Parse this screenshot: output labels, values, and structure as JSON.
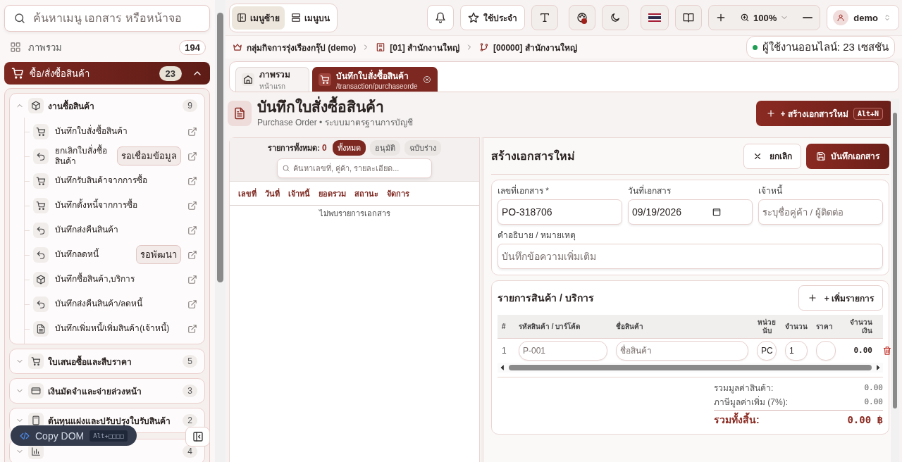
{
  "sidebar": {
    "search": {
      "placeholder": "ค้นหาเมนู เอกสาร หรือหน้าจอ"
    },
    "overview": {
      "label": "ภาพรวม",
      "count": "194"
    },
    "groups": [
      {
        "label": "ซื้อ/สั่งซื้อสินค้า",
        "count": "23",
        "expanded": true,
        "selected": true,
        "children": [
          {
            "label": "งานซื้อสินค้า",
            "count": "9",
            "kind": "box",
            "expanded": true,
            "children": [
              {
                "label": "บันทึกใบสั่งซื้อสินค้า",
                "kind": "cart"
              },
              {
                "label": "ยกเลิกใบสั่งซื้อสินค้า",
                "kind": "return",
                "badge": "รอเชื่อมข้อมูล"
              },
              {
                "label": "บันทึกรับสินค้าจากการซื้อ",
                "kind": "cart"
              },
              {
                "label": "บันทึกตั้งหนี้จากการซื้อ",
                "kind": "cart"
              },
              {
                "label": "บันทึกส่งคืนสินค้า",
                "kind": "return"
              },
              {
                "label": "บันทึกลดหนี้",
                "kind": "return",
                "badge": "รอพัฒนา"
              },
              {
                "label": "บันทึกซื้อสินค้า,บริการ",
                "kind": "box"
              },
              {
                "label": "บันทึกส่งคืนสินค้า/ลดหนี้",
                "kind": "return"
              },
              {
                "label": "บันทึกเพิ่มหนี้/เพิ่มสินค้า(เจ้าหนี้)",
                "kind": "document"
              }
            ]
          },
          {
            "label": "ใบเสนอซื้อและสืบราคา",
            "count": "5",
            "kind": "cart",
            "expanded": false
          },
          {
            "label": "เงินมัดจำและจ่ายล่วงหน้า",
            "count": "3",
            "kind": "card",
            "expanded": false
          },
          {
            "label": "ต้นทุนแฝงและปรับปรุงใบรับสินค้า",
            "count": "2",
            "kind": "calculator",
            "expanded": false
          },
          {
            "count": "4",
            "kind": "chart",
            "expanded": false
          }
        ]
      }
    ]
  },
  "copy_dom": {
    "label": "Copy DOM",
    "shortcut": "Alt+□□□□"
  },
  "layout_toggle": [
    {
      "label": "เมนูซ้าย",
      "kind": "sidebar",
      "selected": true
    },
    {
      "label": "เมนูบน",
      "kind": "topbar",
      "selected": false
    }
  ],
  "toolbar": [
    {
      "kind": "bell"
    },
    {
      "kind": "star",
      "label": "ใช้ประจำ"
    },
    {
      "kind": "text"
    },
    {
      "kind": "palette"
    },
    {
      "kind": "moon"
    },
    {
      "kind": "flag"
    },
    {
      "kind": "book"
    }
  ],
  "zoom": {
    "value": "100%"
  },
  "user": {
    "name": "demo"
  },
  "breadcrumb": [
    {
      "label": "กลุ่มกิจการรุ่งเรืองกรุ๊ป (demo)",
      "kind": "crown"
    },
    {
      "label": "[01] สำนักงานใหญ่",
      "kind": "building"
    },
    {
      "label": "[00000] สำนักงานใหญ่",
      "kind": "branch"
    }
  ],
  "online": {
    "label": "ผู้ใช้งานออนไลน์: 23 เซสชัน"
  },
  "tabs": [
    {
      "title": "ภาพรวม",
      "subtitle": "หน้าแรก",
      "kind": "home",
      "selected": false,
      "closable": false
    },
    {
      "title": "บันทึกใบสั่งซื้อสินค้า",
      "subtitle": "/transaction/purchaseorde",
      "kind": "cart",
      "selected": true,
      "closable": true
    }
  ],
  "page": {
    "title": "บันทึกใบสั่งซื้อสินค้า",
    "subtitle": "Purchase Order • ระบบมาตรฐานการบัญชี",
    "create_button": "+ สร้างเอกสารใหม่",
    "create_shortcut": "Alt+N"
  },
  "list": {
    "total_label": "รายการทั้งหมด:",
    "total": "0",
    "filters": [
      {
        "label": "ทั้งหมด",
        "selected": true
      },
      {
        "label": "อนุมัติ",
        "selected": false
      },
      {
        "label": "ฉบับร่าง",
        "selected": false
      }
    ],
    "search": {
      "placeholder": "ค้นหาเลขที่, คู่ค้า, รายละเอียด..."
    },
    "columns": [
      "เลขที่",
      "วันที่",
      "เจ้าหนี้",
      "ยอดรวม",
      "สถานะ",
      "จัดการ"
    ],
    "empty": "ไม่พบรายการเอกสาร"
  },
  "form": {
    "title": "สร้างเอกสารใหม่",
    "cancel": "ยกเลิก",
    "save": "บันทึกเอกสาร",
    "fields": [
      {
        "label": "เลขที่เอกสาร *",
        "value": "PO-318706",
        "kind": "text"
      },
      {
        "label": "วันที่เอกสาร",
        "value": "09/19/2026",
        "kind": "date"
      },
      {
        "label": "เจ้าหนี้",
        "placeholder": "ระบุชื่อคู่ค้า / ผู้ติดต่อ",
        "kind": "text"
      }
    ],
    "note": {
      "label": "คำอธิบาย / หมายเหตุ",
      "placeholder": "บันทึกข้อความเพิ่มเติม"
    },
    "items": {
      "title": "รายการสินค้า / บริการ",
      "add": "+ เพิ่มรายการ",
      "columns": [
        "#",
        "รหัสสินค้า / บาร์โค้ด",
        "ชื่อสินค้า",
        "หน่วยนับ",
        "จำนวน",
        "ราคา",
        "จำนวนเงิน"
      ],
      "rows": [
        {
          "no": "1",
          "code": {
            "placeholder": "P-001"
          },
          "name": {
            "placeholder": "ชื่อสินค้า"
          },
          "unit": {
            "value": "PC"
          },
          "qty": {
            "value": "1"
          },
          "price": {},
          "amount": "0.00"
        }
      ]
    },
    "totals": [
      {
        "label": "รวมมูลค่าสินค้า:",
        "value": "0.00",
        "kind": "line"
      },
      {
        "label": "ภาษีมูลค่าเพิ่ม (7%):",
        "value": "0.00",
        "kind": "line"
      },
      {
        "label": "รวมทั้งสิ้น:",
        "value": "0.00 ฿",
        "kind": "grand"
      }
    ]
  }
}
